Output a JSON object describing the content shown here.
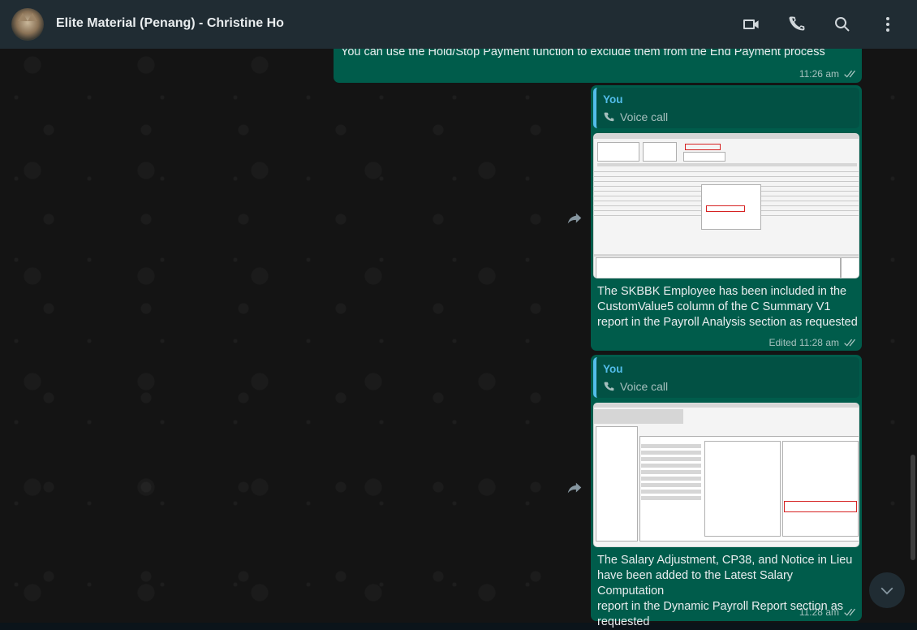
{
  "header": {
    "title": "Elite Material (Penang) - Christine Ho",
    "icons": [
      "video-call-icon",
      "voice-call-icon",
      "search-icon",
      "menu-icon"
    ]
  },
  "messages": [
    {
      "text": "You can use the Hold/Stop Payment function to exclude them from the End Payment process",
      "time": "11:26 am"
    },
    {
      "quote_author": "You",
      "quote_body": "Voice call",
      "caption_lines": [
        "The SKBBK Employee has been included in the",
        "CustomValue5 column of the C Summary V1",
        "report in the Payroll Analysis section as requested"
      ],
      "time": "Edited 11:28 am"
    },
    {
      "quote_author": "You",
      "quote_body": "Voice call",
      "caption_lines": [
        "The Salary Adjustment, CP38, and Notice in Lieu",
        "have been added to the Latest Salary Computation",
        "report in the Dynamic Payroll Report section as",
        "requested"
      ],
      "time": "11:28 am"
    }
  ],
  "colors": {
    "header_bg": "#202c33",
    "outgoing_bubble": "#005c4b",
    "quote_accent": "#53bdeb"
  }
}
